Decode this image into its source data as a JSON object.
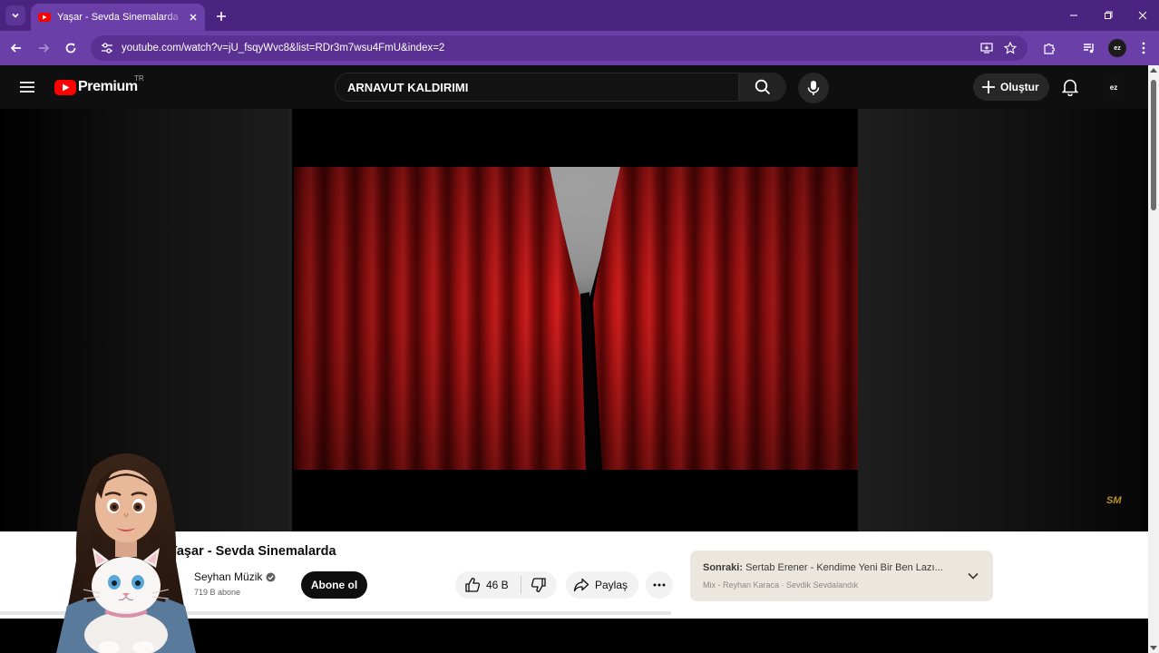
{
  "browser": {
    "tab_title": "Yaşar - Sevda Sinemalarda - YouTube",
    "url": "youtube.com/watch?v=jU_fsqyWvc8&list=RDr3m7wsu4FmU&index=2",
    "profile_initials": "ez"
  },
  "youtube": {
    "logo_text": "Premium",
    "country_code": "TR",
    "search_query": "ARNAVUT KALDIRIMI",
    "create_label": "Oluştur",
    "account_initials": "ez"
  },
  "video": {
    "title": "Yaşar - Sevda Sinemalarda",
    "watermark": "SM",
    "channel_name": "Seyhan Müzik",
    "subscribers": "719 B abone",
    "subscribe_label": "Abone ol",
    "like_count": "46 B",
    "share_label": "Paylaş"
  },
  "up_next": {
    "label": "Sonraki:",
    "title": "Sertab Erener - Kendime Yeni Bir Ben Lazı...",
    "subtitle": "Mix - Reyhan Karaca · Sevdik Sevdalandık"
  },
  "icons": {
    "tab_list": "chevron-down-icon",
    "new_tab": "plus-icon",
    "back": "arrow-left-icon",
    "forward": "arrow-right-icon",
    "reload": "reload-icon",
    "site_info": "tune-icon",
    "install": "install-app-icon",
    "bookmark": "star-icon",
    "extensions": "puzzle-icon",
    "media": "media-queue-icon",
    "more": "kebab-menu-icon",
    "hamburger": "hamburger-menu-icon",
    "search": "search-icon",
    "mic": "microphone-icon",
    "create": "plus-icon",
    "notifications": "bell-icon",
    "verified": "verified-check-icon",
    "like": "thumbs-up-icon",
    "dislike": "thumbs-down-icon",
    "share": "share-arrow-icon",
    "options": "more-horizontal-icon",
    "expand": "chevron-down-icon"
  },
  "colors": {
    "browser_tabstrip": "#4a2480",
    "browser_toolbar": "#6b3fa8",
    "youtube_red": "#ff0000",
    "page_dark": "#0f0f0f",
    "curtain_red": "#b01010",
    "up_next_bg": "#ece7de"
  }
}
